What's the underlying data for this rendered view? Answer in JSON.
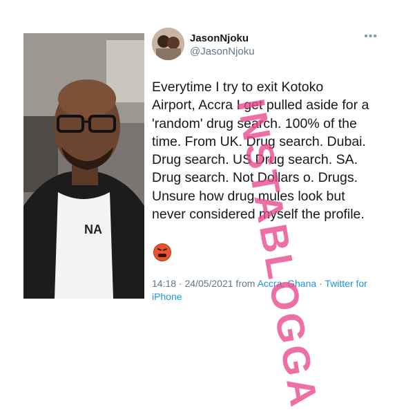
{
  "photo": {
    "label": "person-selfie-in-airplane"
  },
  "tweet": {
    "display_name": "JasonNjoku",
    "handle": "@JasonNjoku",
    "more_icon": "more-horizontal-icon",
    "text": "Everytime I try to exit Kotoko\nAirport, Accra I get pulled aside for a\n'random' drug search. 100% of the\ntime. From UK. Drug search. Dubai.\nDrug search. US Drug search. SA.\nDrug search. Not Dollars o. Drugs.\nUnsure how drug mules look but\nnever considered myself the profile.",
    "emoji": "angry-face-emoji",
    "timestamp": "14:18 · 24/05/2021 from ",
    "location": "Accra, Ghana",
    "separator": " · ",
    "source": "Twitter for iPhone"
  },
  "watermark": {
    "text": "INSTABLOGGA"
  },
  "colors": {
    "link": "#1b95e0",
    "watermark": "#e8468c",
    "secondary_text": "#657786"
  }
}
